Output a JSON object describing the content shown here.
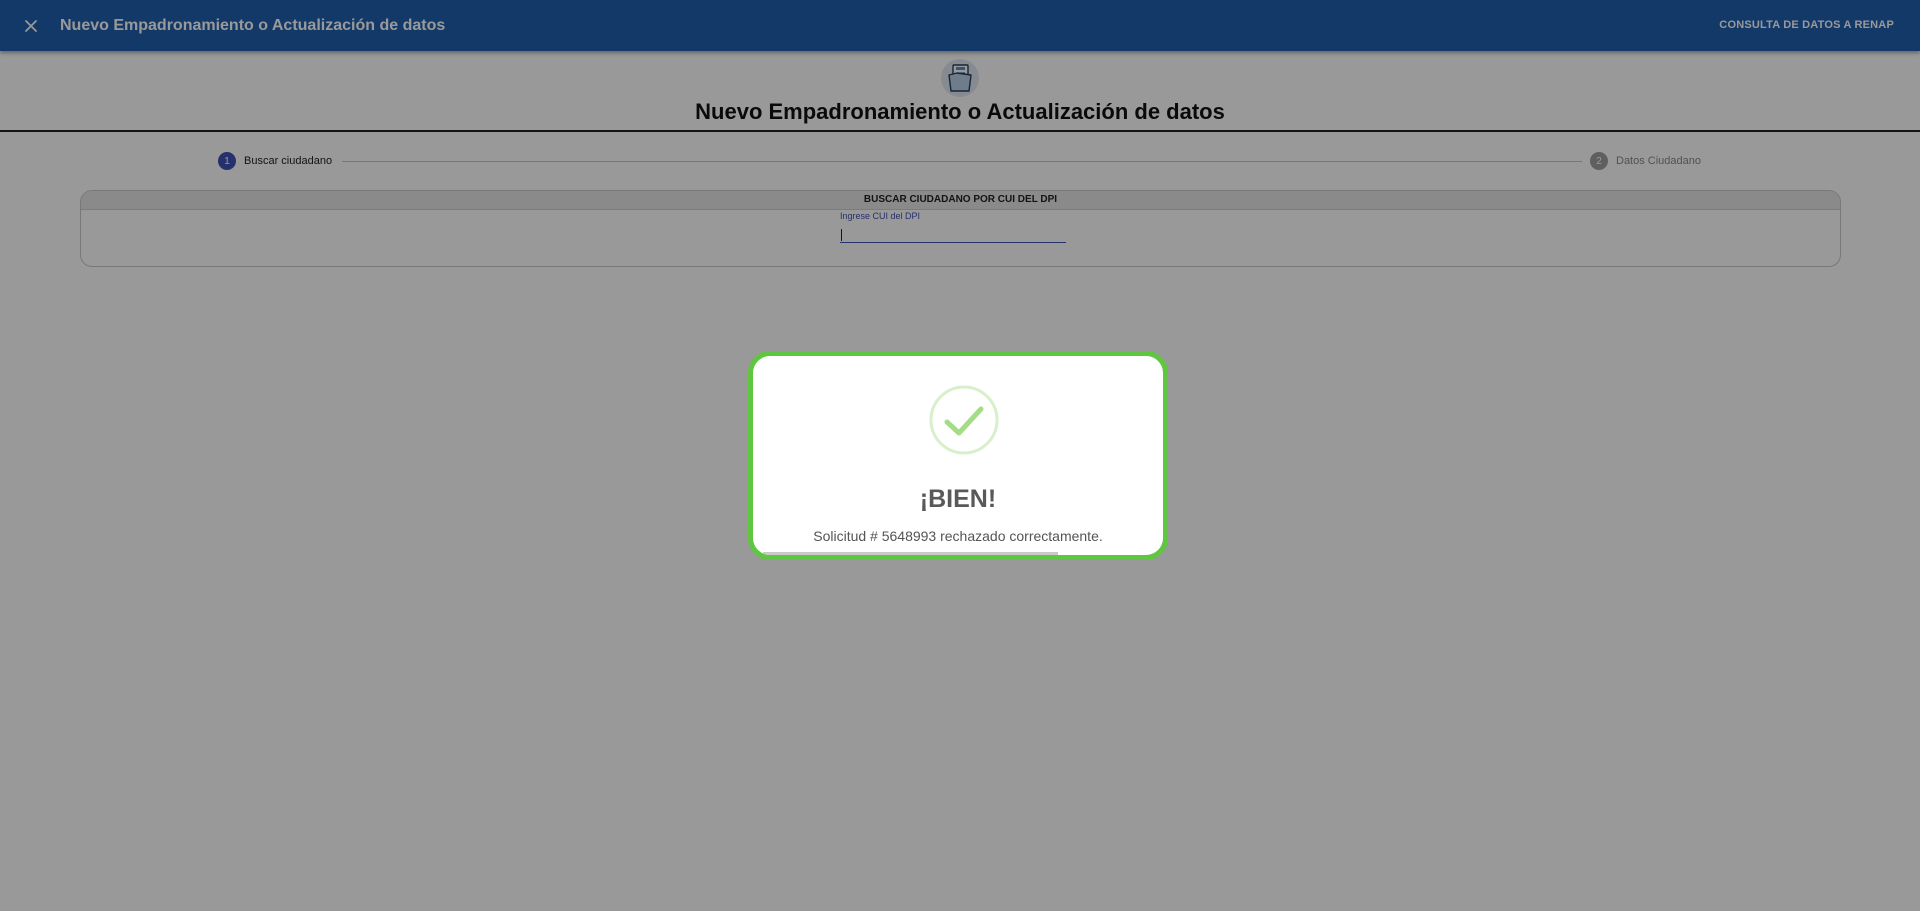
{
  "topbar": {
    "close_icon": "close-icon",
    "title": "Nuevo Empadronamiento o Actualización de datos",
    "action_label": "CONSULTA DE DATOS A RENAP"
  },
  "header": {
    "icon": "folder-document-icon",
    "title": "Nuevo Empadronamiento o Actualización de datos"
  },
  "stepper": {
    "steps": [
      {
        "number": "1",
        "label": "Buscar ciudadano",
        "active": true
      },
      {
        "number": "2",
        "label": "Datos Ciudadano",
        "active": false
      }
    ]
  },
  "search_card": {
    "title": "BUSCAR CIUDADANO POR CUI DEL DPI",
    "field_label": "Ingrese CUI del DPI",
    "field_value": ""
  },
  "dialog": {
    "icon": "success-check-icon",
    "title": "¡BIEN!",
    "message": "Solicitud # 5648993 rechazado correctamente.",
    "timer_progress": 0.72
  },
  "colors": {
    "topbar": "#1e5fae",
    "accent": "#3f51b5",
    "success": "#5fc63f",
    "check": "#a5dc86"
  }
}
